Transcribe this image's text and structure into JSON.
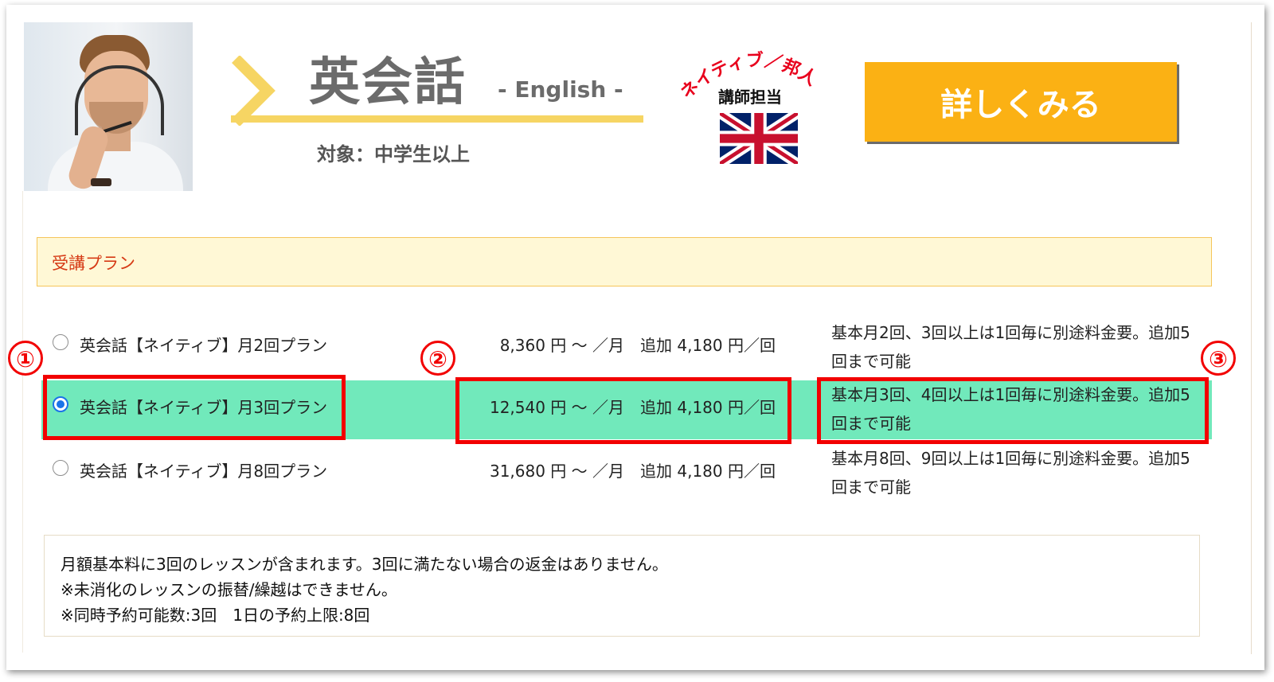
{
  "header": {
    "title": "英会話",
    "subtitle": "- English -",
    "target": "対象：中学生以上",
    "badge_arc_text": "ネイティブ／邦人",
    "badge_label": "講師担当",
    "detail_button": "詳しくみる",
    "icons": [
      "instructor-photo",
      "union-jack-flag-icon"
    ]
  },
  "plan_section": {
    "title": "受講プラン",
    "plans": [
      {
        "name": "英会話【ネイティブ】月2回プラン",
        "price": "8,360 円 〜 ／月　追加 4,180 円／回",
        "desc": "基本月2回、3回以上は1回毎に別途料金要。追加5回まで可能",
        "selected": false
      },
      {
        "name": "英会話【ネイティブ】月3回プラン",
        "price": "12,540 円 〜 ／月　追加 4,180 円／回",
        "desc": "基本月3回、4回以上は1回毎に別途料金要。追加5回まで可能",
        "selected": true
      },
      {
        "name": "英会話【ネイティブ】月8回プラン",
        "price": "31,680 円 〜 ／月　追加 4,180 円／回",
        "desc": "基本月8回、9回以上は1回毎に別途料金要。追加5回まで可能",
        "selected": false
      }
    ]
  },
  "annotations": {
    "marker_1": "①",
    "marker_2": "②",
    "marker_3": "③",
    "highlight_color": "#f20000"
  },
  "notes": [
    "月額基本料に3回のレッスンが含まれます。3回に満たない場合の返金はありません。",
    "※未消化のレッスンの振替/繰越はできません。",
    "※同時予約可能数:3回　1日の予約上限:8回"
  ],
  "colors": {
    "accent_button": "#fbb114",
    "selected_row": "#71e9bb",
    "plan_header_bg": "#fff8d6",
    "plan_header_text": "#d63b16",
    "title_underline": "#f6d563"
  }
}
